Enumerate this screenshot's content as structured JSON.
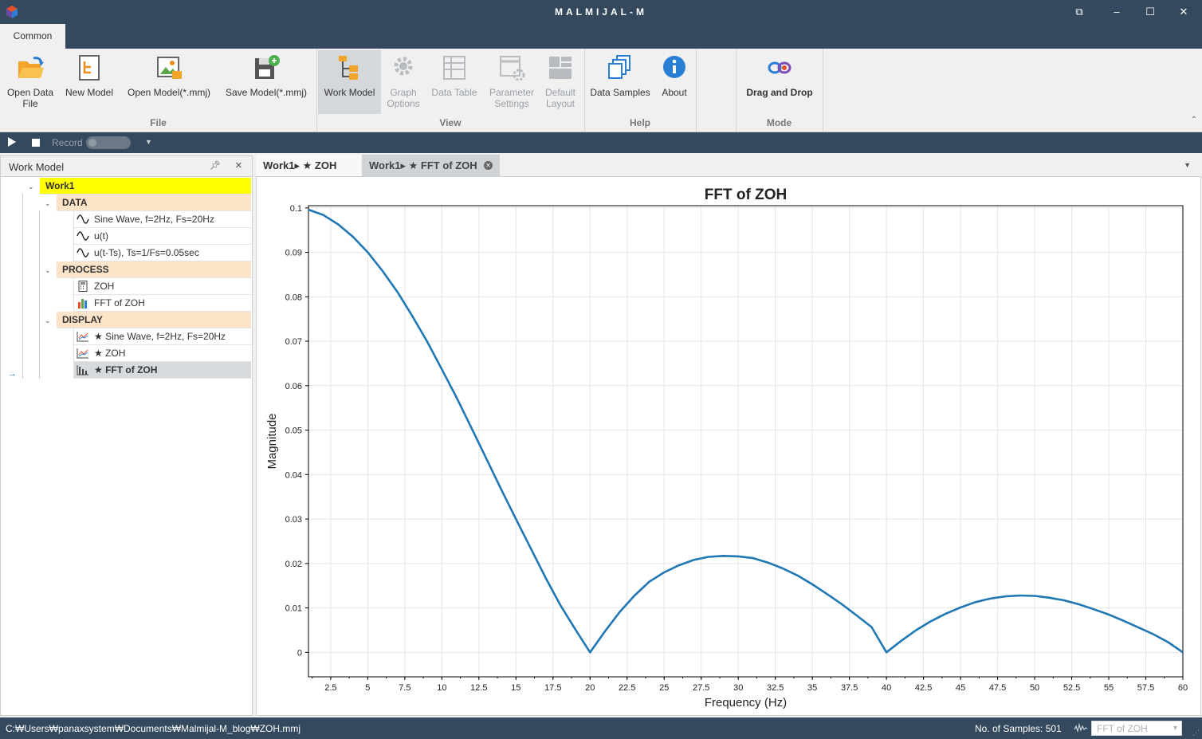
{
  "titlebar": {
    "title": "MALMIJAL-M"
  },
  "ribbon": {
    "tab": "Common",
    "buttons": {
      "open_data_file": "Open Data\nFile",
      "new_model": "New Model",
      "open_model": "Open Model(*.mmj)",
      "save_model": "Save Model(*.mmj)",
      "work_model": "Work Model",
      "graph_options": "Graph\nOptions",
      "data_table": "Data Table",
      "parameter_settings": "Parameter\nSettings",
      "default_layout": "Default\nLayout",
      "data_samples": "Data Samples",
      "about": "About",
      "drag_and_drop": "Drag and Drop"
    },
    "groups": {
      "file": "File",
      "view": "View",
      "help": "Help",
      "mode": "Mode"
    }
  },
  "recbar": {
    "record_label": "Record"
  },
  "work_model_panel": {
    "title": "Work Model",
    "root": "Work1",
    "groups": [
      {
        "label": "DATA",
        "items": [
          "Sine Wave, f=2Hz, Fs=20Hz",
          "u(t)",
          "u(t-Ts), Ts=1/Fs=0.05sec"
        ]
      },
      {
        "label": "PROCESS",
        "items": [
          "ZOH",
          "FFT of ZOH"
        ]
      },
      {
        "label": "DISPLAY",
        "items": [
          "★ Sine Wave, f=2Hz, Fs=20Hz",
          "★ ZOH",
          "★ FFT of ZOH"
        ]
      }
    ]
  },
  "doc_tabs": [
    {
      "label": "Work1▸ ★ ZOH"
    },
    {
      "label": "Work1▸ ★ FFT of ZOH"
    }
  ],
  "statusbar": {
    "path": "C:₩Users₩panaxsystem₩Documents₩Malmijal-M_blog₩ZOH.mmj",
    "samples": "No. of Samples: 501",
    "selector": "FFT of ZOH"
  },
  "colors": {
    "line": "#1f77b4",
    "dark": "#34495e",
    "root_highlight": "#ffff00",
    "group_bg": "#fde3c8"
  },
  "chart_data": {
    "type": "line",
    "title": "FFT of ZOH",
    "xlabel": "Frequency (Hz)",
    "ylabel": "Magnitude",
    "xlim": [
      1,
      60
    ],
    "ylim": [
      -0.0055,
      0.1005
    ],
    "xticks": [
      2.5,
      5,
      7.5,
      10,
      12.5,
      15,
      17.5,
      20,
      22.5,
      25,
      27.5,
      30,
      32.5,
      35,
      37.5,
      40,
      42.5,
      45,
      47.5,
      50,
      52.5,
      55,
      57.5,
      60
    ],
    "xtick_labels": [
      "2.5",
      "5",
      "7.5",
      "10",
      "12.5",
      "15",
      "17.5",
      "20",
      "22.5",
      "25",
      "27.5",
      "30",
      "32.5",
      "35",
      "37.5",
      "40",
      "42.5",
      "45",
      "47.5",
      "50",
      "52.5",
      "55",
      "57.5",
      "60"
    ],
    "yticks": [
      0,
      0.01,
      0.02,
      0.03,
      0.04,
      0.05,
      0.06,
      0.07,
      0.08,
      0.09,
      0.1
    ],
    "ytick_labels": [
      "0",
      "0.01",
      "0.02",
      "0.03",
      "0.04",
      "0.05",
      "0.06",
      "0.07",
      "0.08",
      "0.09",
      "0.1"
    ],
    "grid": true,
    "series": [
      {
        "x": [
          1,
          2,
          3,
          4,
          5,
          6,
          7,
          8,
          9,
          10,
          11,
          12,
          13,
          14,
          15,
          16,
          17,
          18,
          19,
          20,
          21,
          22,
          23,
          24,
          25,
          26,
          27,
          28,
          29,
          30,
          31,
          32,
          33,
          34,
          35,
          36,
          37,
          38,
          39,
          40,
          41,
          42,
          43,
          44,
          45,
          46,
          47,
          48,
          49,
          50,
          51,
          52,
          53,
          54,
          55,
          56,
          57,
          58,
          59,
          60
        ],
        "y": [
          0.0996,
          0.0984,
          0.0963,
          0.0935,
          0.09,
          0.0858,
          0.0811,
          0.0757,
          0.07,
          0.0637,
          0.0573,
          0.0505,
          0.0436,
          0.0367,
          0.03,
          0.0234,
          0.0168,
          0.0106,
          0.0052,
          0.0,
          0.0047,
          0.0091,
          0.0128,
          0.0159,
          0.018,
          0.0196,
          0.0208,
          0.0215,
          0.0217,
          0.0216,
          0.0212,
          0.0202,
          0.0189,
          0.0173,
          0.0153,
          0.0131,
          0.0108,
          0.0083,
          0.0057,
          0.0,
          0.0026,
          0.005,
          0.007,
          0.0087,
          0.0101,
          0.0113,
          0.0121,
          0.0126,
          0.0128,
          0.0127,
          0.0123,
          0.0117,
          0.0108,
          0.0097,
          0.0085,
          0.0071,
          0.0056,
          0.0041,
          0.0023,
          0.0
        ]
      }
    ]
  }
}
